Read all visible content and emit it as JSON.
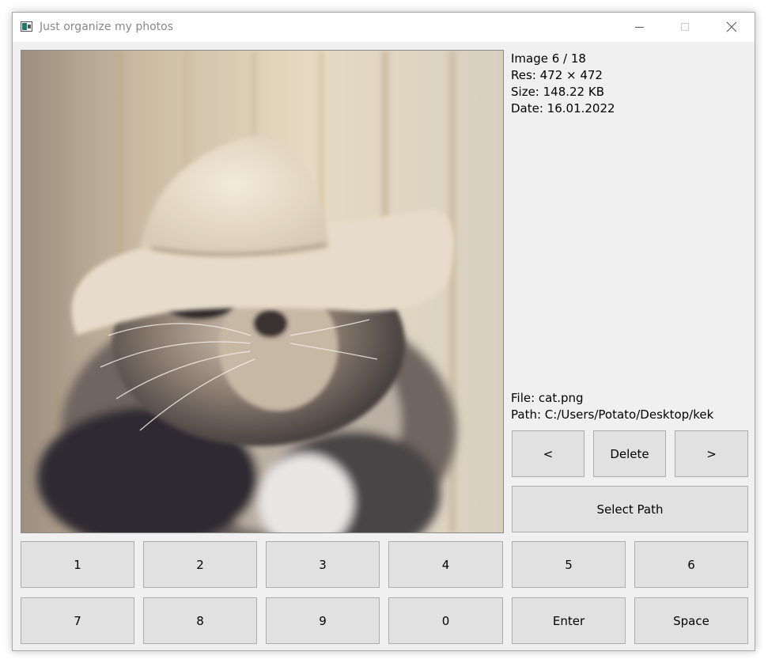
{
  "window": {
    "title": "Just organize my photos"
  },
  "info": {
    "image_counter": "Image 6 / 18",
    "resolution": "Res: 472 × 472",
    "size": "Size: 148.22 KB",
    "date": "Date: 16.01.2022",
    "file": "File: cat.png",
    "path": "Path: C:/Users/Potato/Desktop/kek"
  },
  "nav": {
    "prev_label": "<",
    "delete_label": "Delete",
    "next_label": ">",
    "select_path_label": "Select Path"
  },
  "keypad": {
    "row1": [
      "1",
      "2",
      "3",
      "4",
      "5",
      "6"
    ],
    "row2": [
      "7",
      "8",
      "9",
      "0",
      "Enter",
      "Space"
    ]
  }
}
